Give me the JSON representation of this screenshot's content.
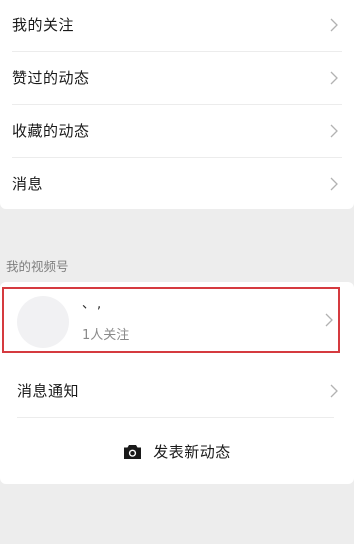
{
  "menu": {
    "items": [
      {
        "label": "我的关注"
      },
      {
        "label": "赞过的动态"
      },
      {
        "label": "收藏的动态"
      },
      {
        "label": "消息"
      }
    ]
  },
  "channel_section": {
    "title": "我的视频号",
    "account": {
      "name": "、,",
      "followers": "1人关注"
    },
    "notifications_label": "消息通知",
    "post_label": "发表新动态"
  },
  "icons": {
    "chevron": "chevron-right-icon",
    "camera": "camera-icon"
  },
  "colors": {
    "page_background": "#ededed",
    "card_background": "#ffffff",
    "highlight_border": "#d53a3f",
    "secondary_text": "#8a8a8a"
  }
}
